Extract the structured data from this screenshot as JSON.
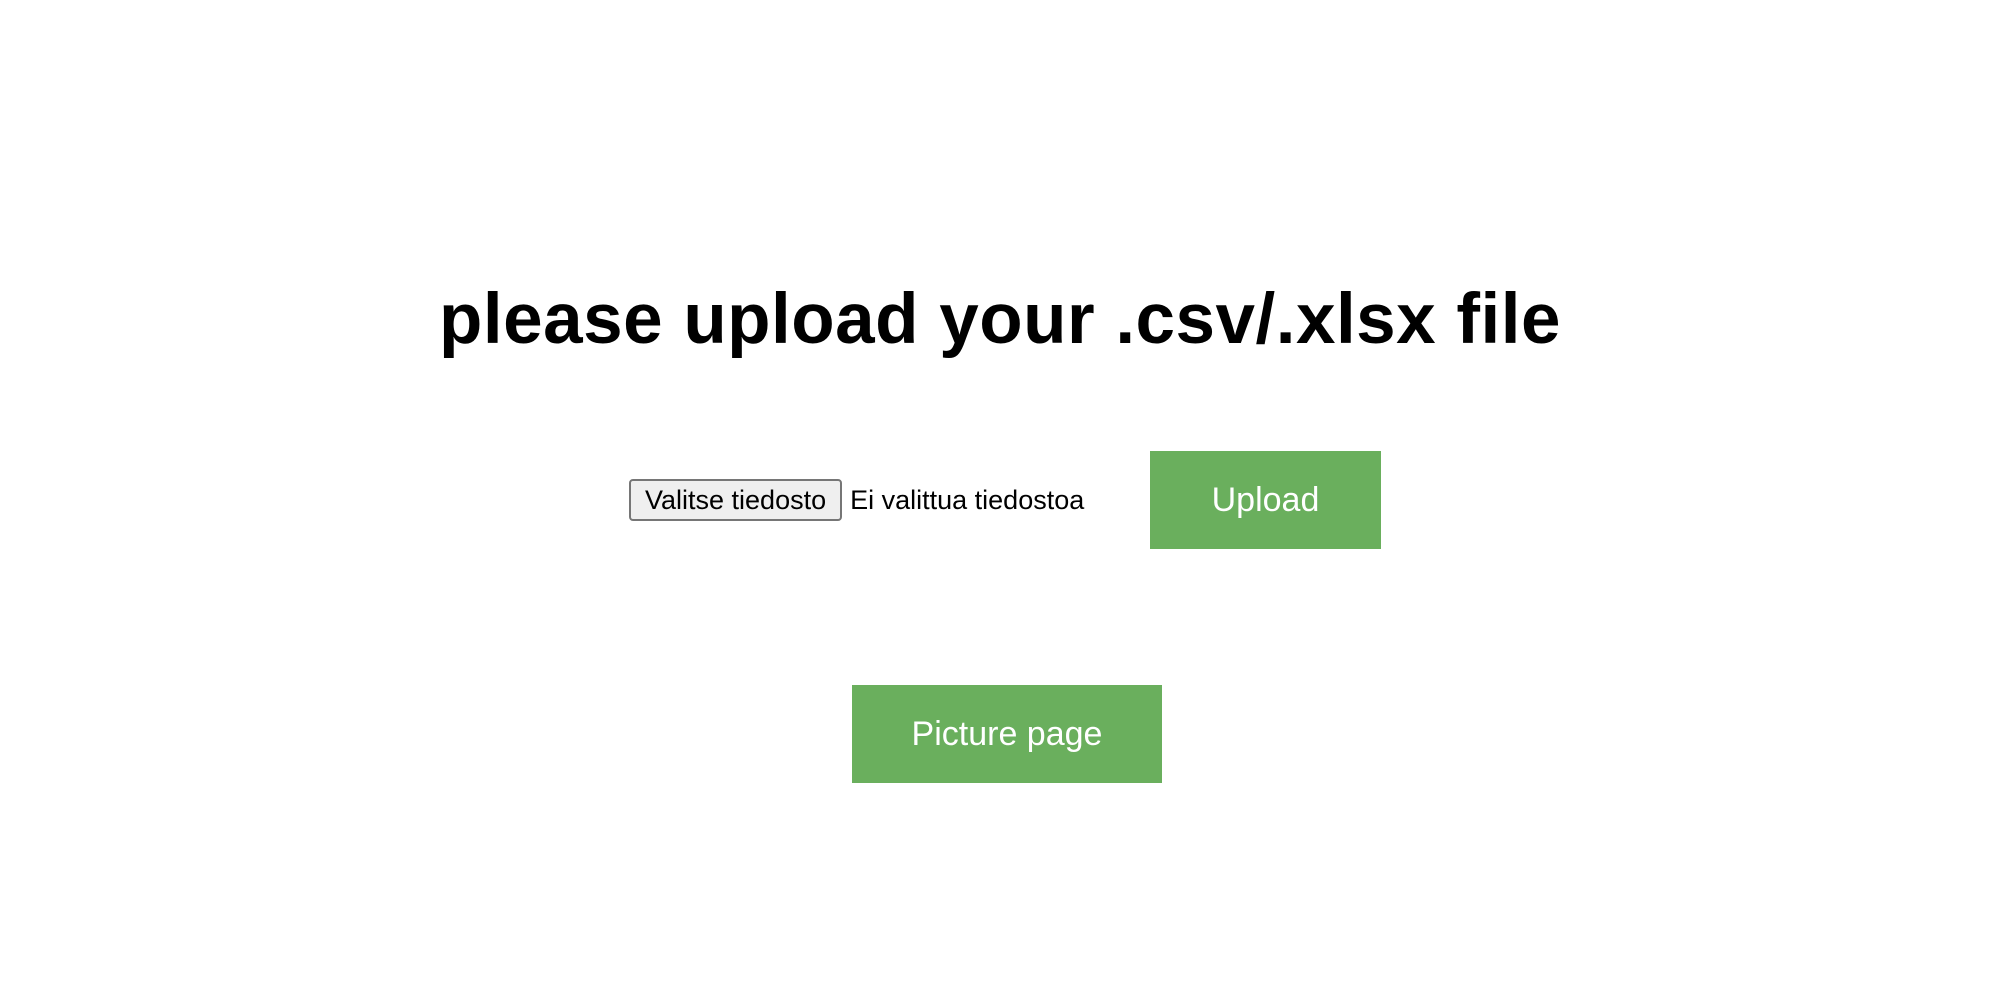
{
  "heading": "please upload your .csv/.xlsx file",
  "file_input": {
    "choose_label": "Valitse tiedosto",
    "status_text": "Ei valittua tiedostoa"
  },
  "upload_button": {
    "label": "Upload"
  },
  "picture_button": {
    "label": "Picture page"
  },
  "colors": {
    "button_green": "#6aaf5d",
    "button_text": "#ffffff",
    "background": "#ffffff"
  }
}
